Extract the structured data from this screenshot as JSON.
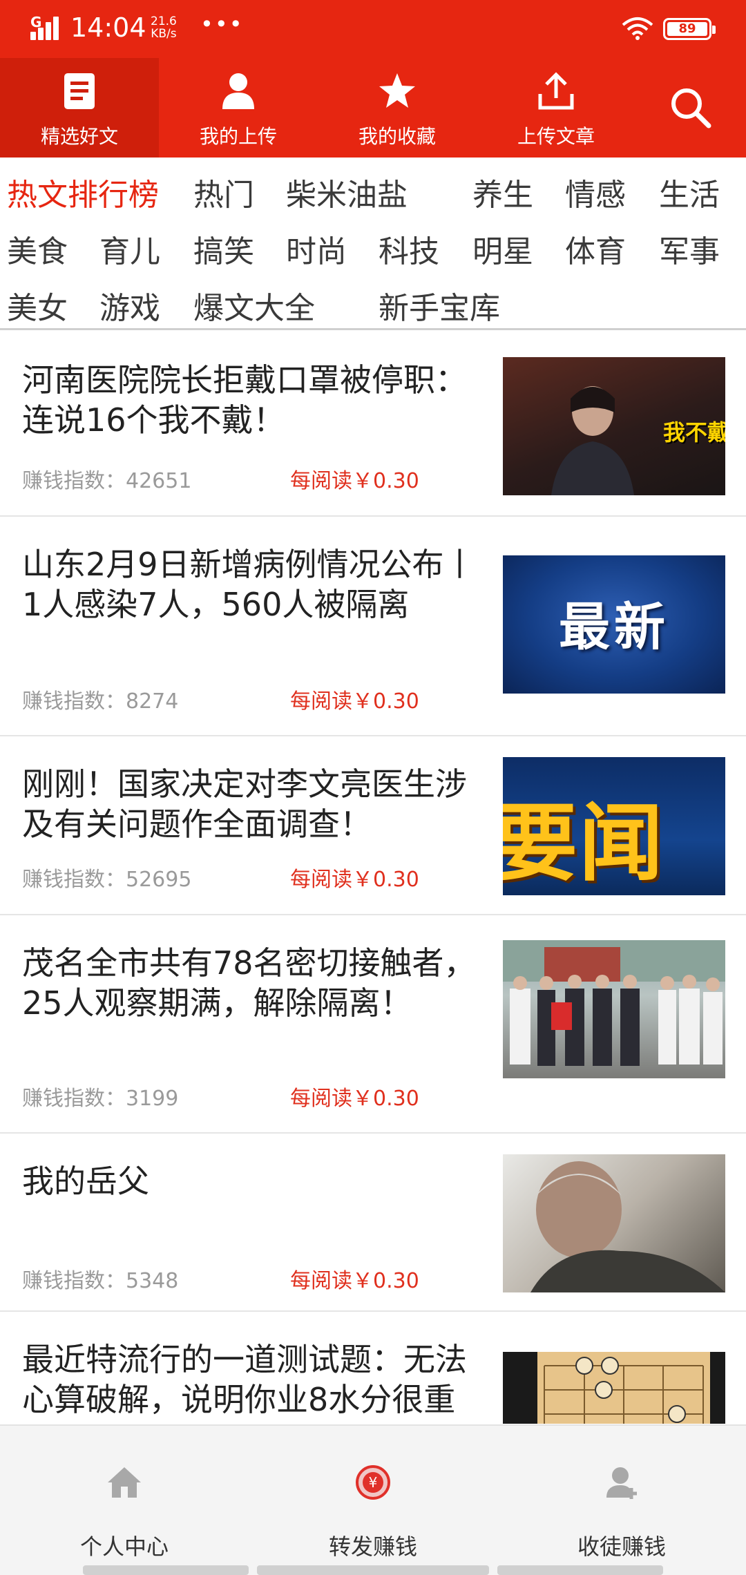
{
  "status_bar": {
    "network": "G",
    "time": "14:04",
    "speed_value": "21.6",
    "speed_unit": "KB/s",
    "more": "•••",
    "battery": "89"
  },
  "top_nav": {
    "items": [
      {
        "label": "精选好文",
        "icon": "article-icon"
      },
      {
        "label": "我的上传",
        "icon": "user-icon"
      },
      {
        "label": "我的收藏",
        "icon": "star-icon"
      },
      {
        "label": "上传文章",
        "icon": "upload-icon"
      }
    ],
    "search_icon": "search-icon",
    "accent_color": "#e62611"
  },
  "categories": [
    "热文排行榜",
    "热门",
    "柴米油盐",
    "养生",
    "情感",
    "生活",
    "美食",
    "育儿",
    "搞笑",
    "时尚",
    "科技",
    "明星",
    "体育",
    "军事",
    "美女",
    "游戏",
    "爆文大全",
    "新手宝库"
  ],
  "articles": [
    {
      "title": "河南医院院长拒戴口罩被停职：连说16个我不戴！",
      "index_label": "赚钱指数：",
      "index_value": "42651",
      "pay": "每阅读￥0.30",
      "thumb_caption": "我不戴"
    },
    {
      "title": "山东2月9日新增病例情况公布丨1人感染7人，560人被隔离",
      "index_label": "赚钱指数：",
      "index_value": "8274",
      "pay": "每阅读￥0.30",
      "thumb_caption": "最新"
    },
    {
      "title": "刚刚！国家决定对李文亮医生涉及有关问题作全面调查！",
      "index_label": "赚钱指数：",
      "index_value": "52695",
      "pay": "每阅读￥0.30",
      "thumb_caption": "要闻"
    },
    {
      "title": "茂名全市共有78名密切接触者，25人观察期满，解除隔离！",
      "index_label": "赚钱指数：",
      "index_value": "3199",
      "pay": "每阅读￥0.30",
      "thumb_caption": ""
    },
    {
      "title": "我的岳父",
      "index_label": "赚钱指数：",
      "index_value": "5348",
      "pay": "每阅读￥0.30",
      "thumb_caption": ""
    },
    {
      "title": "最近特流行的一道测试题：无法心算破解，说明你业8水分很重",
      "index_label": "",
      "index_value": "",
      "pay": "",
      "thumb_caption": ""
    }
  ],
  "bottom_tabs": [
    {
      "label": "个人中心",
      "icon": "home-icon"
    },
    {
      "label": "转发赚钱",
      "icon": "yuan-coin-icon"
    },
    {
      "label": "收徒赚钱",
      "icon": "person-add-icon"
    }
  ]
}
